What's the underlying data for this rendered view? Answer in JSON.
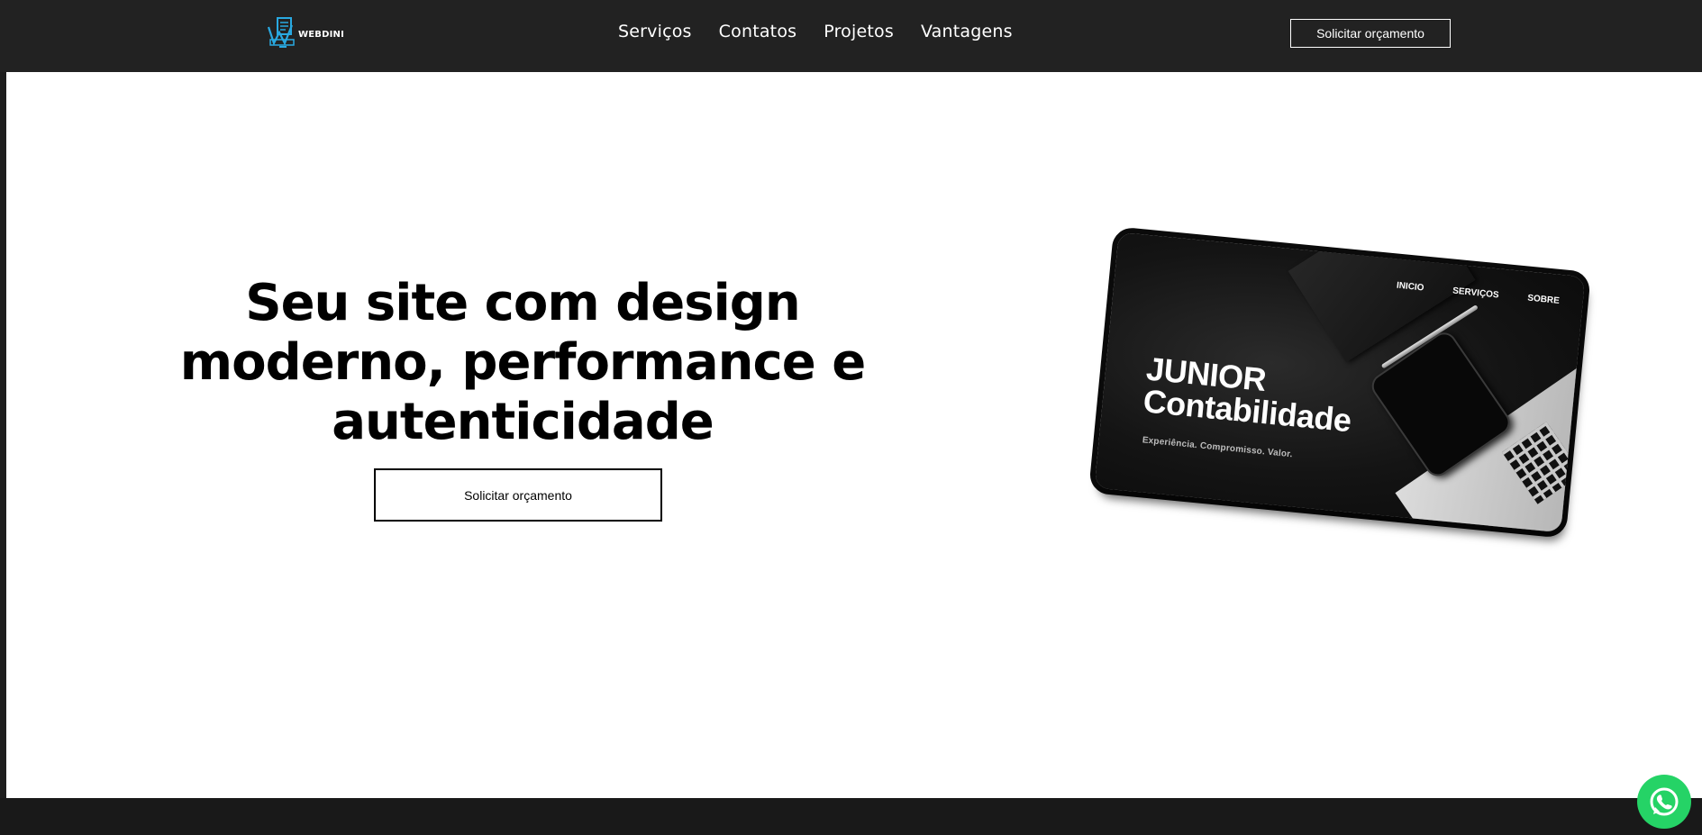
{
  "header": {
    "logo_text": "WEBDINI",
    "nav": [
      {
        "label": "Serviços"
      },
      {
        "label": "Contatos"
      },
      {
        "label": "Projetos"
      },
      {
        "label": "Vantagens"
      }
    ],
    "cta_label": "Solicitar orçamento"
  },
  "hero": {
    "title": "Seu site com design moderno, performance e autenticidade",
    "cta_label": "Solicitar orçamento"
  },
  "mockup": {
    "nav": [
      "INICIO",
      "SERVIÇOS",
      "SOBRE"
    ],
    "title_line1": "JUNIOR",
    "title_line2": "Contabilidade",
    "tagline": "Experiência. Compromisso. Valor."
  },
  "icons": {
    "logo": "monitor-document-icon",
    "whatsapp": "whatsapp-icon"
  },
  "colors": {
    "header_bg": "#222222",
    "logo_accent": "#29a9e1",
    "whatsapp": "#25d366"
  }
}
